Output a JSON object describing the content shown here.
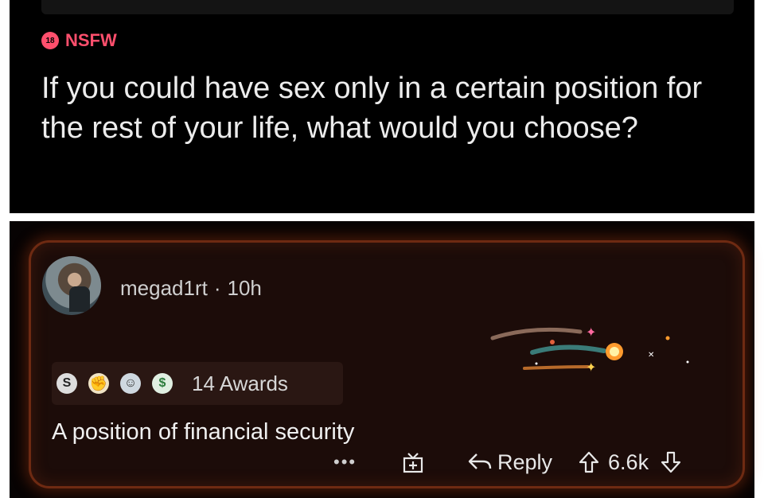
{
  "post": {
    "nsfw_badge": "18",
    "nsfw_label": "NSFW",
    "title": "If you could have sex only in a certain position for the rest of your life, what would you choose?"
  },
  "comment": {
    "username": "megad1rt",
    "separator": "·",
    "age": "10h",
    "award_icons": [
      "silver-award-icon",
      "wholesome-award-icon",
      "hugz-award-icon",
      "take-my-money-award-icon"
    ],
    "silver_glyph": "S",
    "awards_count_label": "14 Awards",
    "body": "A position of financial security",
    "actions": {
      "more_label": "•••",
      "reply_label": "Reply",
      "score": "6.6k"
    }
  },
  "colors": {
    "nsfw": "#ff4f6d",
    "card_border": "#6e2a12",
    "card_bg": "#1c0c09"
  }
}
